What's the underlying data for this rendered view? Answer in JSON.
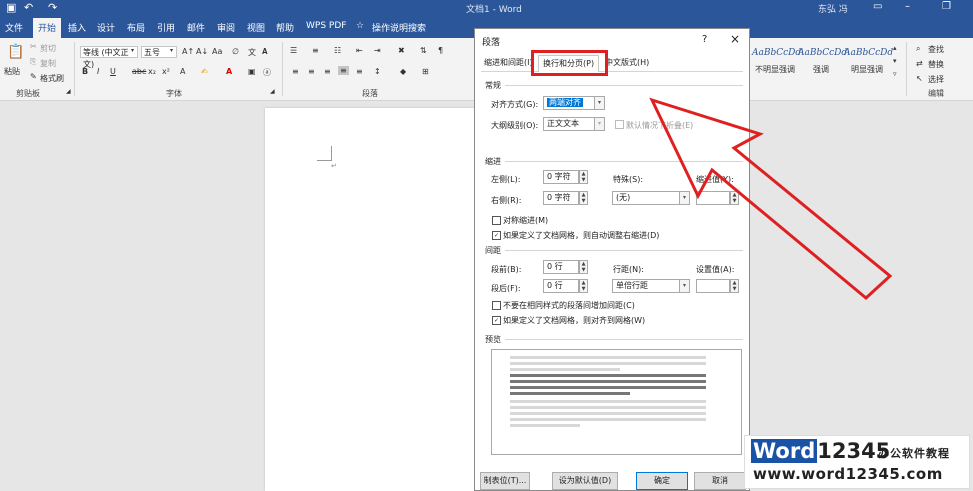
{
  "window": {
    "title": "文档1 - Word",
    "user": "东弘 冯",
    "quick_access": [
      "save-icon",
      "undo-icon",
      "redo-icon"
    ]
  },
  "tabs": [
    "文件",
    "开始",
    "插入",
    "设计",
    "布局",
    "引用",
    "邮件",
    "审阅",
    "视图",
    "帮助",
    "WPS PDF",
    "操作说明搜索"
  ],
  "active_tab": "开始",
  "ribbon": {
    "clipboard": {
      "label": "剪贴板",
      "paste": "粘贴",
      "cut": "剪切",
      "copy": "复制",
      "format_painter": "格式刷"
    },
    "font": {
      "label": "字体",
      "font_name": "等线 (中文正文)",
      "font_size": "五号"
    },
    "paragraph": {
      "label": "段落"
    },
    "styles": [
      {
        "sample": "AaBbCcDd",
        "name": "不明显强调"
      },
      {
        "sample": "AaBbCcDd",
        "name": "强调"
      },
      {
        "sample": "AaBbCcDd",
        "name": "明显强调"
      }
    ],
    "editing": {
      "label": "编辑",
      "find": "查找",
      "replace": "替换",
      "select": "选择"
    }
  },
  "dialog": {
    "title": "段落",
    "help": "?",
    "close": "×",
    "tabs": [
      "缩进和间距(I)",
      "换行和分页(P)",
      "中文版式(H)"
    ],
    "selected_tab": "换行和分页(P)",
    "general": {
      "heading": "常规",
      "alignment_label": "对齐方式(G):",
      "alignment_value": "两端对齐",
      "outline_label": "大纲级别(O):",
      "outline_value": "正文文本",
      "collapsed_label": "默认情况下折叠(E)"
    },
    "indent": {
      "heading": "缩进",
      "left_label": "左侧(L):",
      "left_value": "0 字符",
      "right_label": "右侧(R):",
      "right_value": "0 字符",
      "special_label": "特殊(S):",
      "special_value": "(无)",
      "by_label": "缩进值(Y):",
      "by_value": "",
      "mirror_label": "对称缩进(M)",
      "mirror_checked": false,
      "auto_adjust_label": "如果定义了文档网格，则自动调整右缩进(D)",
      "auto_adjust_checked": true
    },
    "spacing": {
      "heading": "间距",
      "before_label": "段前(B):",
      "before_value": "0 行",
      "after_label": "段后(F):",
      "after_value": "0 行",
      "line_label": "行距(N):",
      "line_value": "单倍行距",
      "at_label": "设置值(A):",
      "at_value": "",
      "no_space_label": "不要在相同样式的段落间增加间距(C)",
      "no_space_checked": false,
      "snap_grid_label": "如果定义了文档网格，则对齐到网格(W)",
      "snap_grid_checked": true
    },
    "preview": {
      "heading": "预览"
    },
    "buttons": {
      "tabs": "制表位(T)...",
      "default": "设为默认值(D)",
      "ok": "确定",
      "cancel": "取消"
    }
  },
  "watermark": {
    "logo_word": "Word",
    "logo_num": "12345",
    "cn_text": "办公软件教程",
    "url": "www.word12345.com"
  },
  "colors": {
    "accent": "#2b579a",
    "highlight": "#e02020"
  }
}
